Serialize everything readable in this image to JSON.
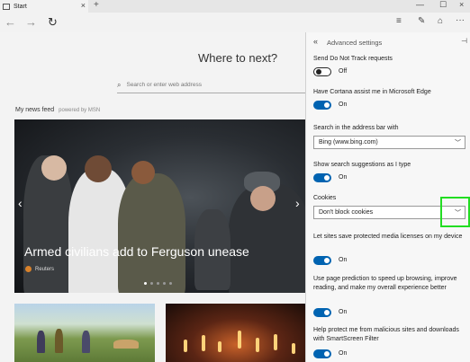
{
  "browser": {
    "tab_title": "Start",
    "close_glyph": "×",
    "new_tab_glyph": "+",
    "back_glyph": "←",
    "forward_glyph": "→",
    "refresh_glyph": "↻",
    "minimize_glyph": "—",
    "maximize_glyph": "☐",
    "reading_list_glyph": "≡",
    "note_glyph": "✎",
    "share_glyph": "⌂",
    "more_glyph": "···"
  },
  "start_page": {
    "heading": "Where to next?",
    "search_placeholder": "Search or enter web address",
    "search_glyph": "⌕",
    "news_feed_label": "My news feed",
    "powered_by": "powered by MSN",
    "headline": "Armed civilians add to Ferguson unease",
    "source": "Reuters",
    "carousel_pages": 5,
    "carousel_active": 1
  },
  "settings": {
    "title": "Advanced settings",
    "back_glyph": "«",
    "pin_glyph": "⊣",
    "do_not_track": {
      "label": "Send Do Not Track requests",
      "state": "Off"
    },
    "cortana": {
      "label": "Have Cortana assist me in Microsoft Edge",
      "state": "On"
    },
    "search_engine": {
      "label": "Search in the address bar with",
      "value": "Bing (www.bing.com)"
    },
    "suggestions": {
      "label": "Show search suggestions as I type",
      "state": "On"
    },
    "cookies": {
      "label": "Cookies",
      "value": "Don't block cookies"
    },
    "media_licenses": {
      "label": "Let sites save protected media licenses on my device",
      "state": "On"
    },
    "page_prediction": {
      "label": "Use page prediction to speed up browsing, improve reading, and make my overall experience better",
      "state": "On"
    },
    "smartscreen": {
      "label": "Help protect me from malicious sites and downloads with SmartScreen Filter",
      "state": "On"
    },
    "chevron_glyph": "﹀"
  },
  "colors": {
    "accent": "#0063b1",
    "highlight": "#22dd22"
  }
}
